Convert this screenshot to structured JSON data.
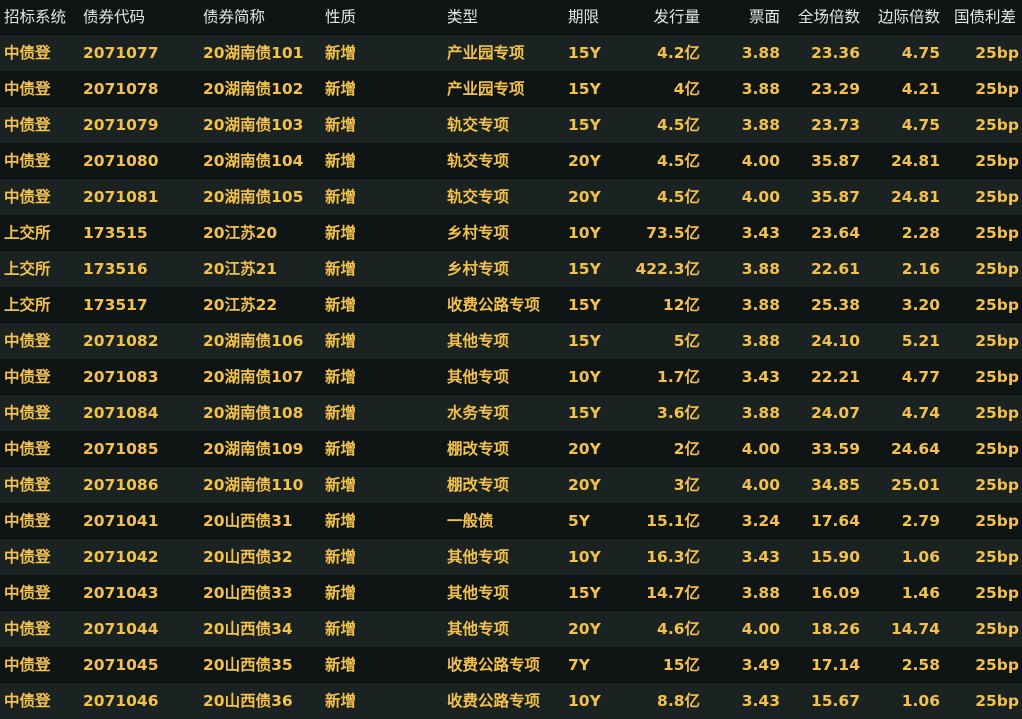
{
  "table": {
    "headers": [
      "招标系统",
      "债券代码",
      "债券简称",
      "性质",
      "类型",
      "期限",
      "发行量",
      "票面",
      "全场倍数",
      "边际倍数",
      "国债利差"
    ],
    "rows": [
      [
        "中债登",
        "2071077",
        "20湖南债101",
        "新增",
        "产业园专项",
        "15Y",
        "4.2亿",
        "3.88",
        "23.36",
        "4.75",
        "25bp"
      ],
      [
        "中债登",
        "2071078",
        "20湖南债102",
        "新增",
        "产业园专项",
        "15Y",
        "4亿",
        "3.88",
        "23.29",
        "4.21",
        "25bp"
      ],
      [
        "中债登",
        "2071079",
        "20湖南债103",
        "新增",
        "轨交专项",
        "15Y",
        "4.5亿",
        "3.88",
        "23.73",
        "4.75",
        "25bp"
      ],
      [
        "中债登",
        "2071080",
        "20湖南债104",
        "新增",
        "轨交专项",
        "20Y",
        "4.5亿",
        "4.00",
        "35.87",
        "24.81",
        "25bp"
      ],
      [
        "中债登",
        "2071081",
        "20湖南债105",
        "新增",
        "轨交专项",
        "20Y",
        "4.5亿",
        "4.00",
        "35.87",
        "24.81",
        "25bp"
      ],
      [
        "上交所",
        "173515",
        "20江苏20",
        "新增",
        "乡村专项",
        "10Y",
        "73.5亿",
        "3.43",
        "23.64",
        "2.28",
        "25bp"
      ],
      [
        "上交所",
        "173516",
        "20江苏21",
        "新增",
        "乡村专项",
        "15Y",
        "422.3亿",
        "3.88",
        "22.61",
        "2.16",
        "25bp"
      ],
      [
        "上交所",
        "173517",
        "20江苏22",
        "新增",
        "收费公路专项",
        "15Y",
        "12亿",
        "3.88",
        "25.38",
        "3.20",
        "25bp"
      ],
      [
        "中债登",
        "2071082",
        "20湖南债106",
        "新增",
        "其他专项",
        "15Y",
        "5亿",
        "3.88",
        "24.10",
        "5.21",
        "25bp"
      ],
      [
        "中债登",
        "2071083",
        "20湖南债107",
        "新增",
        "其他专项",
        "10Y",
        "1.7亿",
        "3.43",
        "22.21",
        "4.77",
        "25bp"
      ],
      [
        "中债登",
        "2071084",
        "20湖南债108",
        "新增",
        "水务专项",
        "15Y",
        "3.6亿",
        "3.88",
        "24.07",
        "4.74",
        "25bp"
      ],
      [
        "中债登",
        "2071085",
        "20湖南债109",
        "新增",
        "棚改专项",
        "20Y",
        "2亿",
        "4.00",
        "33.59",
        "24.64",
        "25bp"
      ],
      [
        "中债登",
        "2071086",
        "20湖南债110",
        "新增",
        "棚改专项",
        "20Y",
        "3亿",
        "4.00",
        "34.85",
        "25.01",
        "25bp"
      ],
      [
        "中债登",
        "2071041",
        "20山西债31",
        "新增",
        "一般债",
        "5Y",
        "15.1亿",
        "3.24",
        "17.64",
        "2.79",
        "25bp"
      ],
      [
        "中债登",
        "2071042",
        "20山西债32",
        "新增",
        "其他专项",
        "10Y",
        "16.3亿",
        "3.43",
        "15.90",
        "1.06",
        "25bp"
      ],
      [
        "中债登",
        "2071043",
        "20山西债33",
        "新增",
        "其他专项",
        "15Y",
        "14.7亿",
        "3.88",
        "16.09",
        "1.46",
        "25bp"
      ],
      [
        "中债登",
        "2071044",
        "20山西债34",
        "新增",
        "其他专项",
        "20Y",
        "4.6亿",
        "4.00",
        "18.26",
        "14.74",
        "25bp"
      ],
      [
        "中债登",
        "2071045",
        "20山西债35",
        "新增",
        "收费公路专项",
        "7Y",
        "15亿",
        "3.49",
        "17.14",
        "2.58",
        "25bp"
      ],
      [
        "中债登",
        "2071046",
        "20山西债36",
        "新增",
        "收费公路专项",
        "10Y",
        "8.8亿",
        "3.43",
        "15.67",
        "1.06",
        "25bp"
      ]
    ]
  },
  "colors": {
    "background": "#0f1414",
    "row_alt": "#1a2322",
    "data_text": "#f2c14e",
    "header_text": "#e6e6e6"
  }
}
